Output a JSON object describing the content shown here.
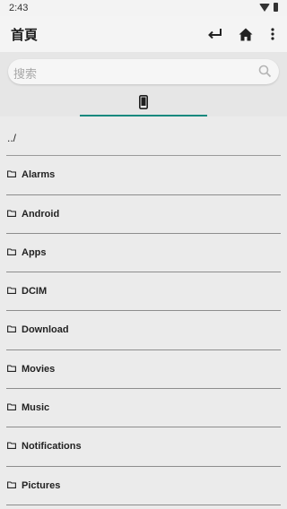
{
  "status": {
    "time": "2:43"
  },
  "appbar": {
    "title": "首頁"
  },
  "search": {
    "placeholder": "搜索"
  },
  "list": {
    "parent": "../",
    "folders": [
      "Alarms",
      "Android",
      "Apps",
      "DCIM",
      "Download",
      "Movies",
      "Music",
      "Notifications",
      "Pictures"
    ]
  },
  "colors": {
    "accent": "#13897e",
    "background": "#ebebeb"
  }
}
